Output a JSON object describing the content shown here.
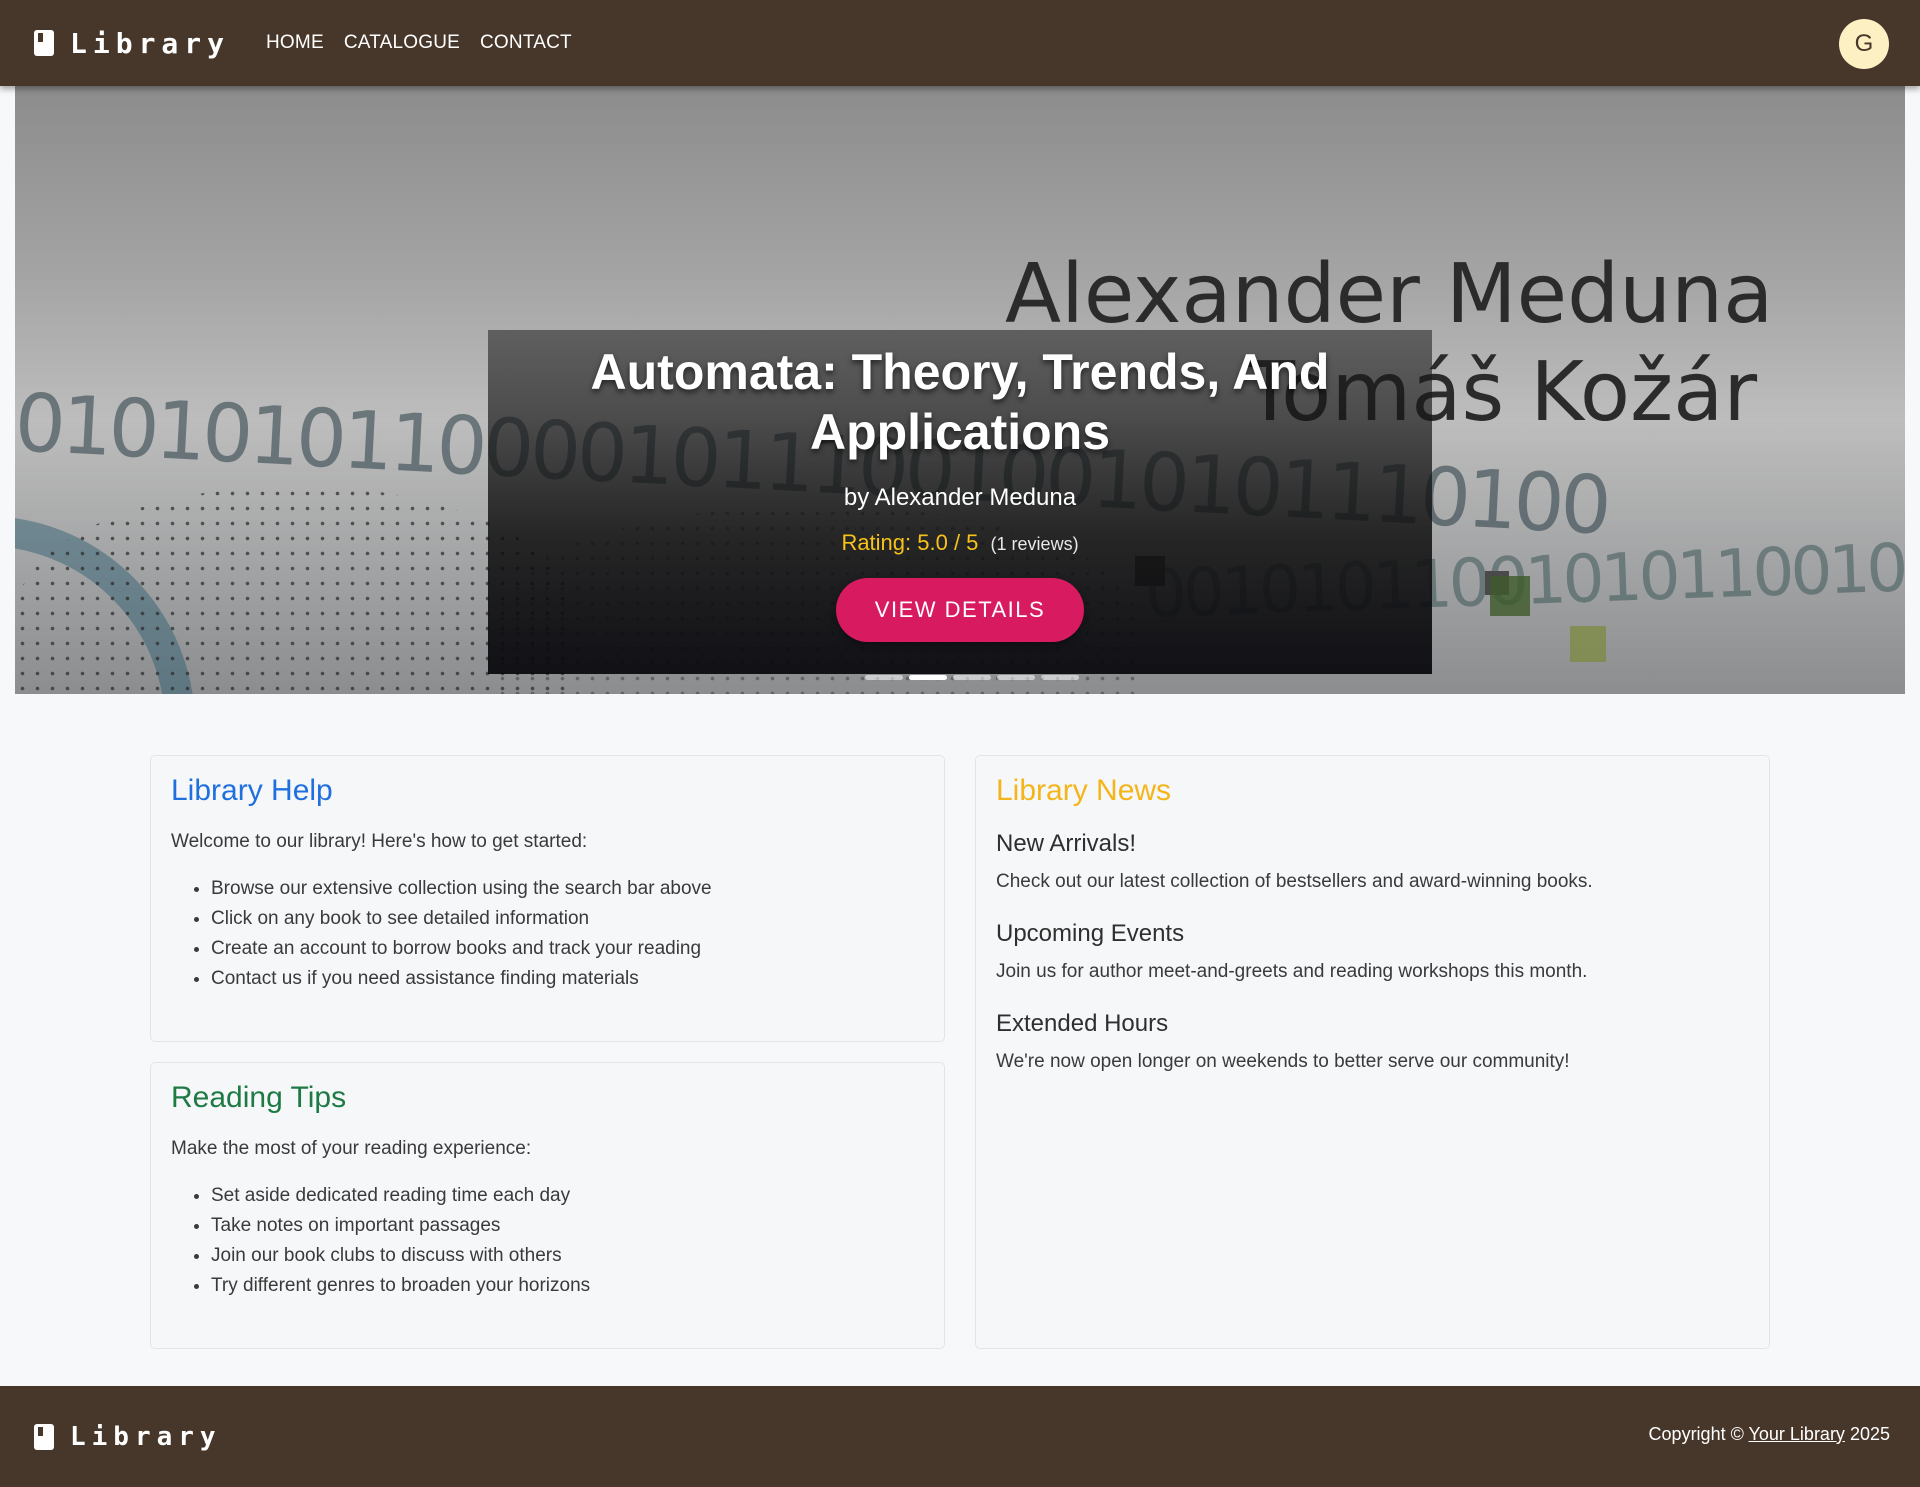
{
  "nav": {
    "brand": "Library",
    "links": [
      "HOME",
      "CATALOGUE",
      "CONTACT"
    ],
    "avatar_initial": "G"
  },
  "hero": {
    "cover_author_line1": "Alexander Meduna",
    "cover_author_line2": "Tomáš Kožár",
    "title": "Automata: Theory, Trends, And Applications",
    "author": "by Alexander Meduna",
    "rating": "Rating: 5.0 / 5",
    "reviews": "(1 reviews)",
    "button": "VIEW DETAILS",
    "slide_count": 5,
    "active_slide": 2
  },
  "help": {
    "title": "Library Help",
    "intro": "Welcome to our library! Here's how to get started:",
    "items": [
      "Browse our extensive collection using the search bar above",
      "Click on any book to see detailed information",
      "Create an account to borrow books and track your reading",
      "Contact us if you need assistance finding materials"
    ]
  },
  "tips": {
    "title": "Reading Tips",
    "intro": "Make the most of your reading experience:",
    "items": [
      "Set aside dedicated reading time each day",
      "Take notes on important passages",
      "Join our book clubs to discuss with others",
      "Try different genres to broaden your horizons"
    ]
  },
  "news": {
    "title": "Library News",
    "items": [
      {
        "heading": "New Arrivals!",
        "text": "Check out our latest collection of bestsellers and award-winning books."
      },
      {
        "heading": "Upcoming Events",
        "text": "Join us for author meet-and-greets and reading workshops this month."
      },
      {
        "heading": "Extended Hours",
        "text": "We're now open longer on weekends to better serve our community!"
      }
    ]
  },
  "footer": {
    "brand": "Library",
    "copyright_prefix": "Copyright ©",
    "copyright_link": "Your Library",
    "year": "2025"
  },
  "colors": {
    "nav_bg": "#47372a",
    "accent_button": "#d81b60",
    "rating": "#f7c21a",
    "help_title": "#1f6fde",
    "tips_title": "#1e7a44",
    "news_title": "#f4b51a"
  }
}
